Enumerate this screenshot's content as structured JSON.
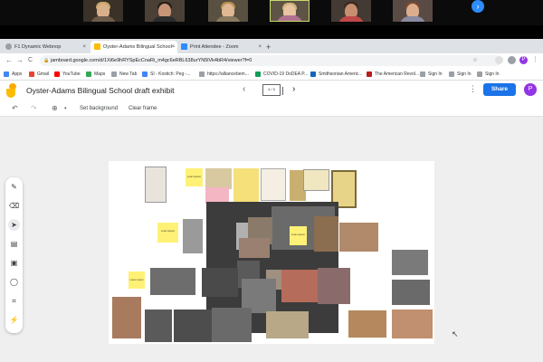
{
  "colors": {
    "chrome_bg": "#dee1e6",
    "share_blue": "#1a73e8",
    "avatar_purple": "#9334e6",
    "sticky_yellow": "#fff176",
    "canvas_bg": "#efefef"
  },
  "zoom": {
    "next_icon": "chevron-right-icon"
  },
  "browser": {
    "tabs": [
      {
        "label": "F1 Dynamic Webnop"
      },
      {
        "label": "Oyster-Adams Bilingual School -"
      },
      {
        "label": "Print Attendee - Zoom"
      }
    ],
    "new_tab": "+",
    "back": "←",
    "forward": "→",
    "reload": "C",
    "url": "jamboard.google.com/d/1Xi6e9hRYSpEcCnaRi_m4gc6eRBL638urYN5lVk4bR4/viewer?f=0",
    "bookmarks": [
      {
        "label": "Apps"
      },
      {
        "label": "Gmail"
      },
      {
        "label": "YouTube"
      },
      {
        "label": "Maps"
      },
      {
        "label": "New Tab"
      },
      {
        "label": "SI - Kostich: Peg -..."
      },
      {
        "label": "https://alliancebem..."
      },
      {
        "label": "COVID-19 DoDEA P..."
      },
      {
        "label": "Smithsonian Americ..."
      },
      {
        "label": "The American Revol..."
      },
      {
        "label": "Sign In"
      },
      {
        "label": "Sign In"
      },
      {
        "label": "Sign In"
      }
    ],
    "profile_initial": "P"
  },
  "jamboard": {
    "title": "Oyster-Adams Bilingual School draft exhibit",
    "frame_counter": "4 / 5",
    "share_label": "Share",
    "avatar_initial": "P",
    "more": "⋮",
    "prev": "‹",
    "next": "›"
  },
  "action_bar": {
    "undo": "↶",
    "redo": "↷",
    "zoom": "⊕",
    "zoom_caret": "▾",
    "set_background": "Set background",
    "clear_frame": "Clear frame"
  },
  "tools": [
    {
      "name": "pen-tool",
      "glyph": "✎"
    },
    {
      "name": "eraser-tool",
      "glyph": "⌫"
    },
    {
      "name": "select-tool",
      "glyph": "➤"
    },
    {
      "name": "sticky-note-tool",
      "glyph": "▤"
    },
    {
      "name": "add-image-tool",
      "glyph": "▣"
    },
    {
      "name": "circle-tool",
      "glyph": "◯"
    },
    {
      "name": "text-box-tool",
      "glyph": "⌗"
    },
    {
      "name": "laser-tool",
      "glyph": "⚡"
    }
  ],
  "sticky_notes": [
    {
      "text": "Lorem ipsum"
    },
    {
      "text": "Lorem ipsum"
    },
    {
      "text": "Lorem ipsum"
    },
    {
      "text": "Lorem ipsum"
    }
  ]
}
